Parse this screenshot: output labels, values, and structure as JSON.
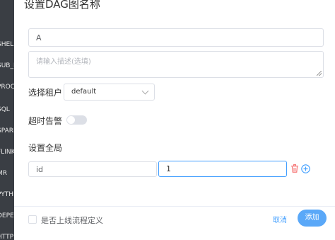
{
  "background_sidebar": {
    "items": [
      "SHELL",
      "SUB_P",
      "PROC",
      "SQL",
      "SPARK",
      "FLINK",
      "MR",
      "PYTH",
      "DEPE",
      "HTTP"
    ]
  },
  "dialog": {
    "title": "设置DAG图名称",
    "name_value": "A",
    "desc_placeholder": "请输入描述(选填)",
    "tenant_label": "选择租户",
    "tenant_value": "default",
    "timeout_label": "超时告警",
    "timeout_enabled": false,
    "global_label": "设置全局",
    "global_param_key": "id",
    "global_param_value": "1",
    "online_label": "是否上线流程定义",
    "online_checked": false,
    "cancel_label": "取消",
    "add_label": "添加"
  },
  "colors": {
    "primary": "#409eff",
    "danger": "#f56c6c",
    "sidebar_bg": "#3a3e44"
  }
}
